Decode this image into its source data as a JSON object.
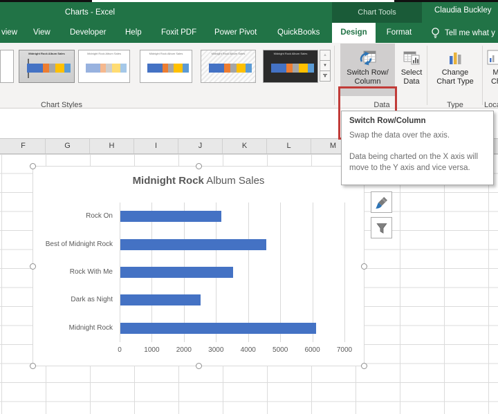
{
  "titlebar": {
    "document_title": "Charts - Excel",
    "contextual_label": "Chart Tools",
    "user_name": "Claudia Buckley"
  },
  "tabs": [
    {
      "label": "view",
      "partial": true
    },
    {
      "label": "View"
    },
    {
      "label": "Developer"
    },
    {
      "label": "Help"
    },
    {
      "label": "Foxit PDF"
    },
    {
      "label": "Power Pivot"
    },
    {
      "label": "QuickBooks"
    },
    {
      "label": "Design",
      "active": true,
      "contextual": true
    },
    {
      "label": "Format",
      "contextual": true
    }
  ],
  "tell_me": {
    "label": "Tell me what y"
  },
  "ribbon": {
    "chart_styles_group_label": "Chart Styles",
    "data_group_label": "Data",
    "type_group_label": "Type",
    "location_group_label": "Loca",
    "switch_row_column": {
      "line1": "Switch Row/",
      "line2": "Column",
      "highlighted": true
    },
    "select_data": {
      "line1": "Select",
      "line2": "Data"
    },
    "change_chart_type": {
      "line1": "Change",
      "line2": "Chart Type"
    },
    "move_chart_partial": {
      "line1": "M",
      "line2": "Ch"
    },
    "gallery_styles": [
      {
        "name": "chart-style-cut",
        "variant": "partial"
      },
      {
        "name": "chart-style-selected",
        "variant": "selected"
      },
      {
        "name": "chart-style-muted",
        "variant": "muted"
      },
      {
        "name": "chart-style-plain",
        "variant": "plain"
      },
      {
        "name": "chart-style-hatched",
        "variant": "hatched"
      },
      {
        "name": "chart-style-dark",
        "variant": "dark"
      }
    ],
    "gallery_palette": [
      "#4472C4",
      "#ED7D31",
      "#A5A5A5",
      "#FFC000",
      "#5B9BD5"
    ]
  },
  "tooltip": {
    "title": "Switch Row/Column",
    "para1": "Swap the data over the axis.",
    "para2": "Data being charted on the X axis will move to the Y axis and vice versa."
  },
  "sheet": {
    "column_headers": [
      "F",
      "G",
      "H",
      "I",
      "J",
      "K",
      "L",
      "M"
    ]
  },
  "chart_data": {
    "type": "bar",
    "orientation": "horizontal",
    "title": "Midnight Rock Album Sales",
    "title_bold": "Midnight Rock",
    "title_regular": " Album Sales",
    "categories": [
      "Rock On",
      "Best of Midnight Rock",
      "Rock With Me",
      "Dark as Night",
      "Midnight Rock"
    ],
    "values": [
      3150,
      4550,
      3500,
      2500,
      6100
    ],
    "xticks": [
      0,
      1000,
      2000,
      3000,
      4000,
      5000,
      6000,
      7000
    ],
    "xlim": [
      0,
      7000
    ],
    "bar_color": "#4472C4",
    "grid": "vertical",
    "legend": "none"
  },
  "colors": {
    "excel_green": "#217346",
    "contextual_green": "#1A5B38",
    "highlight_red": "#C13B38",
    "bar_blue": "#4472C4",
    "chart_text": "#595959"
  }
}
